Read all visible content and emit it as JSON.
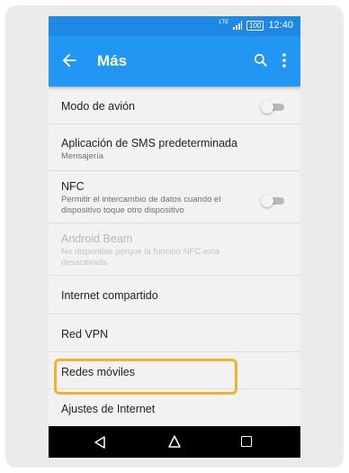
{
  "status_bar": {
    "network": "LTE",
    "battery": "100",
    "time": "12:40"
  },
  "app_bar": {
    "title": "Más",
    "icons": [
      "arrow-back-icon",
      "search-icon",
      "more-vert-icon"
    ]
  },
  "colors": {
    "accent": "#2196f3",
    "status_bar": "#1e88e5",
    "highlight": "#f0b429"
  },
  "items": [
    {
      "title": "Modo de avión",
      "subtitle": "",
      "toggle": "off"
    },
    {
      "title": "Aplicación de SMS predeterminada",
      "subtitle": "Mensajería"
    },
    {
      "title": "NFC",
      "subtitle": "Permitir el intercambio de datos cuando el dispositivo toque otro dispositivo",
      "toggle": "off"
    },
    {
      "title": "Android Beam",
      "subtitle": "No disponible porque la función NFC está desactivada",
      "enabled": false
    },
    {
      "title": "Internet compartido",
      "subtitle": ""
    },
    {
      "title": "Red VPN",
      "subtitle": ""
    },
    {
      "title": "Redes móviles",
      "subtitle": "",
      "highlighted": true
    },
    {
      "title": "Ajustes de Internet",
      "subtitle": ""
    }
  ],
  "nav_bar": {
    "icons": [
      "nav-back-icon",
      "nav-home-icon",
      "nav-recents-icon"
    ]
  }
}
